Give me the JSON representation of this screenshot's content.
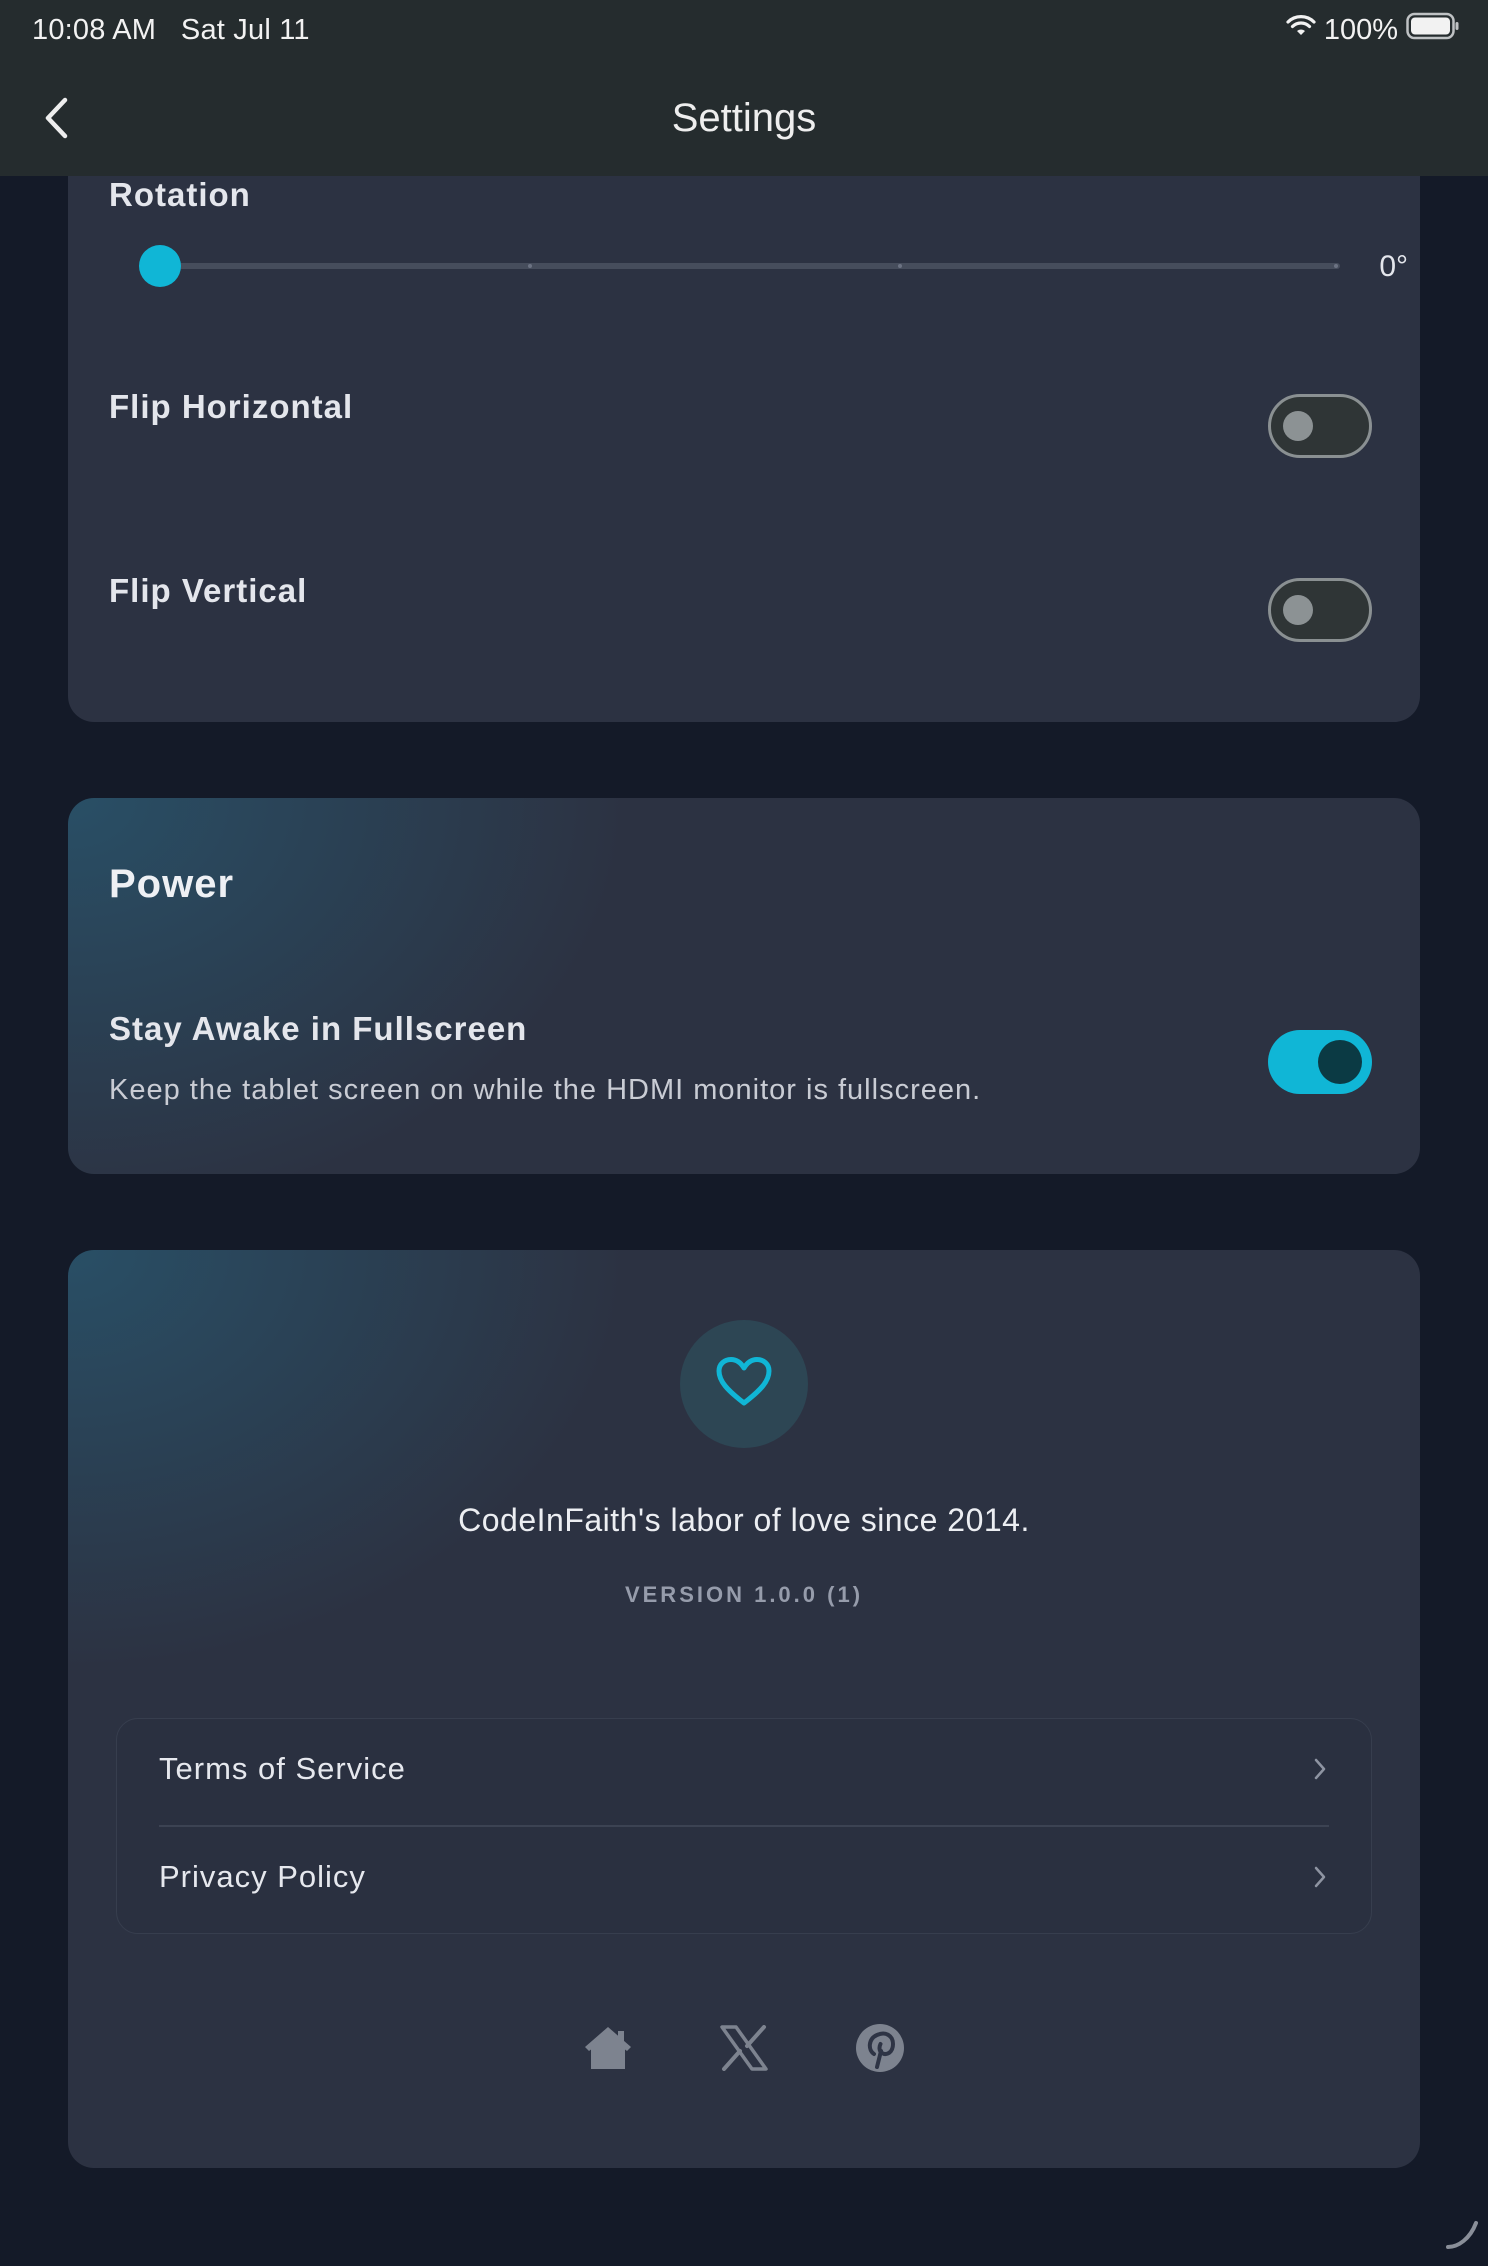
{
  "status_bar": {
    "time": "10:08 AM",
    "date": "Sat Jul 11",
    "battery": "100%",
    "icons": [
      "wifi-icon",
      "battery-icon"
    ]
  },
  "nav": {
    "title": "Settings",
    "back_icon": "chevron-left-icon"
  },
  "display_section": {
    "rotation": {
      "label": "Rotation",
      "value_text": "0°",
      "value": 0
    },
    "flip_horizontal": {
      "label": "Flip Horizontal",
      "enabled": false
    },
    "flip_vertical": {
      "label": "Flip Vertical",
      "enabled": false
    }
  },
  "power_section": {
    "title": "Power",
    "stay_awake": {
      "label": "Stay Awake in Fullscreen",
      "description": "Keep the tablet screen on while the HDMI monitor is fullscreen.",
      "enabled": true
    }
  },
  "about_section": {
    "icon": "heart-icon",
    "tagline": "CodeInFaith's labor of love since 2014.",
    "version": "VERSION 1.0.0 (1)",
    "links": [
      {
        "label": "Terms of Service"
      },
      {
        "label": "Privacy Policy"
      }
    ],
    "social": [
      "home-icon",
      "x-icon",
      "pinterest-icon"
    ]
  },
  "colors": {
    "accent": "#10b6d6",
    "background": "#141a28",
    "card": "#2c3242",
    "topbar": "#252c2e"
  }
}
